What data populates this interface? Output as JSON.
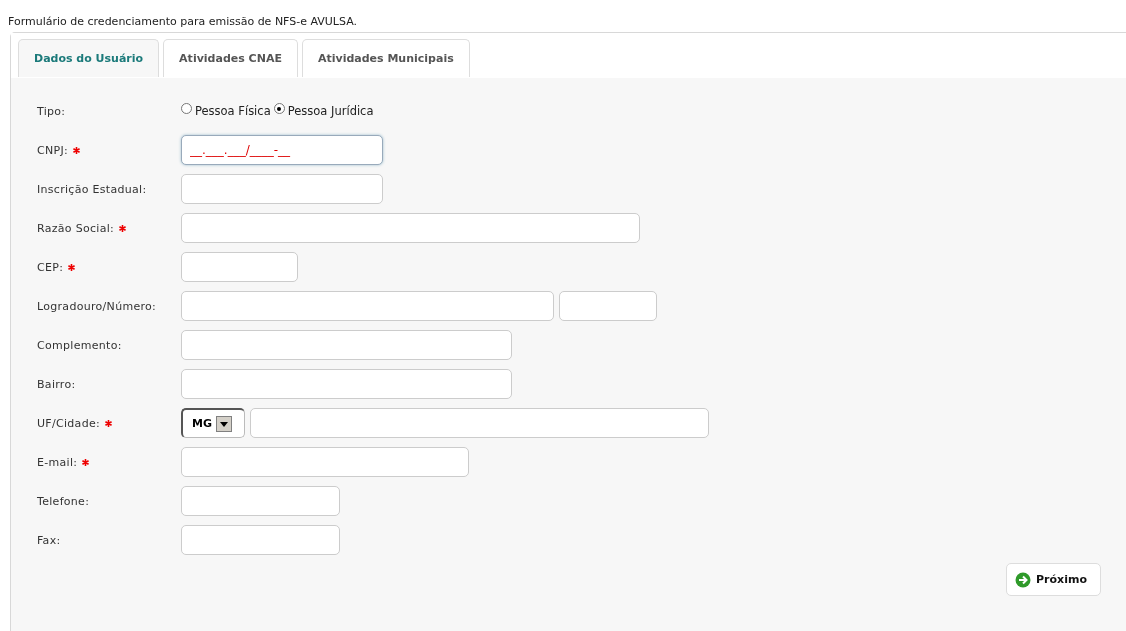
{
  "heading": "Formulário de credenciamento para emissão de NFS-e AVULSA.",
  "tabs": [
    {
      "label": "Dados do Usuário",
      "selected": true
    },
    {
      "label": "Atividades CNAE",
      "selected": false
    },
    {
      "label": "Atividades Municipais",
      "selected": false
    }
  ],
  "fields": [
    {
      "kind": "radio",
      "label": "Tipo:",
      "required": false,
      "options": [
        {
          "label": "Pessoa Física",
          "selected": false
        },
        {
          "label": "Pessoa Jurídica",
          "selected": true
        }
      ]
    },
    {
      "kind": "text",
      "label": "CNPJ:",
      "required": true,
      "value": "__.___.___/____-__",
      "focused": true
    },
    {
      "kind": "text",
      "label": "Inscrição Estadual:",
      "required": false,
      "focused": false
    },
    {
      "kind": "text",
      "label": "Razão Social:",
      "required": true,
      "focused": false
    },
    {
      "kind": "text",
      "label": "CEP:",
      "required": true,
      "focused": false
    },
    {
      "kind": "double",
      "label": "Logradouro/Número:",
      "required": false
    },
    {
      "kind": "text",
      "label": "Complemento:",
      "required": false,
      "focused": false
    },
    {
      "kind": "text",
      "label": "Bairro:",
      "required": false,
      "focused": false
    },
    {
      "kind": "uf",
      "label": "UF/Cidade:",
      "required": true,
      "uf": "MG"
    },
    {
      "kind": "text",
      "label": "E-mail:",
      "required": true,
      "focused": false
    },
    {
      "kind": "text",
      "label": "Telefone:",
      "required": false,
      "focused": false
    },
    {
      "kind": "text",
      "label": "Fax:",
      "required": false,
      "focused": false
    }
  ],
  "next_button": "Próximo"
}
